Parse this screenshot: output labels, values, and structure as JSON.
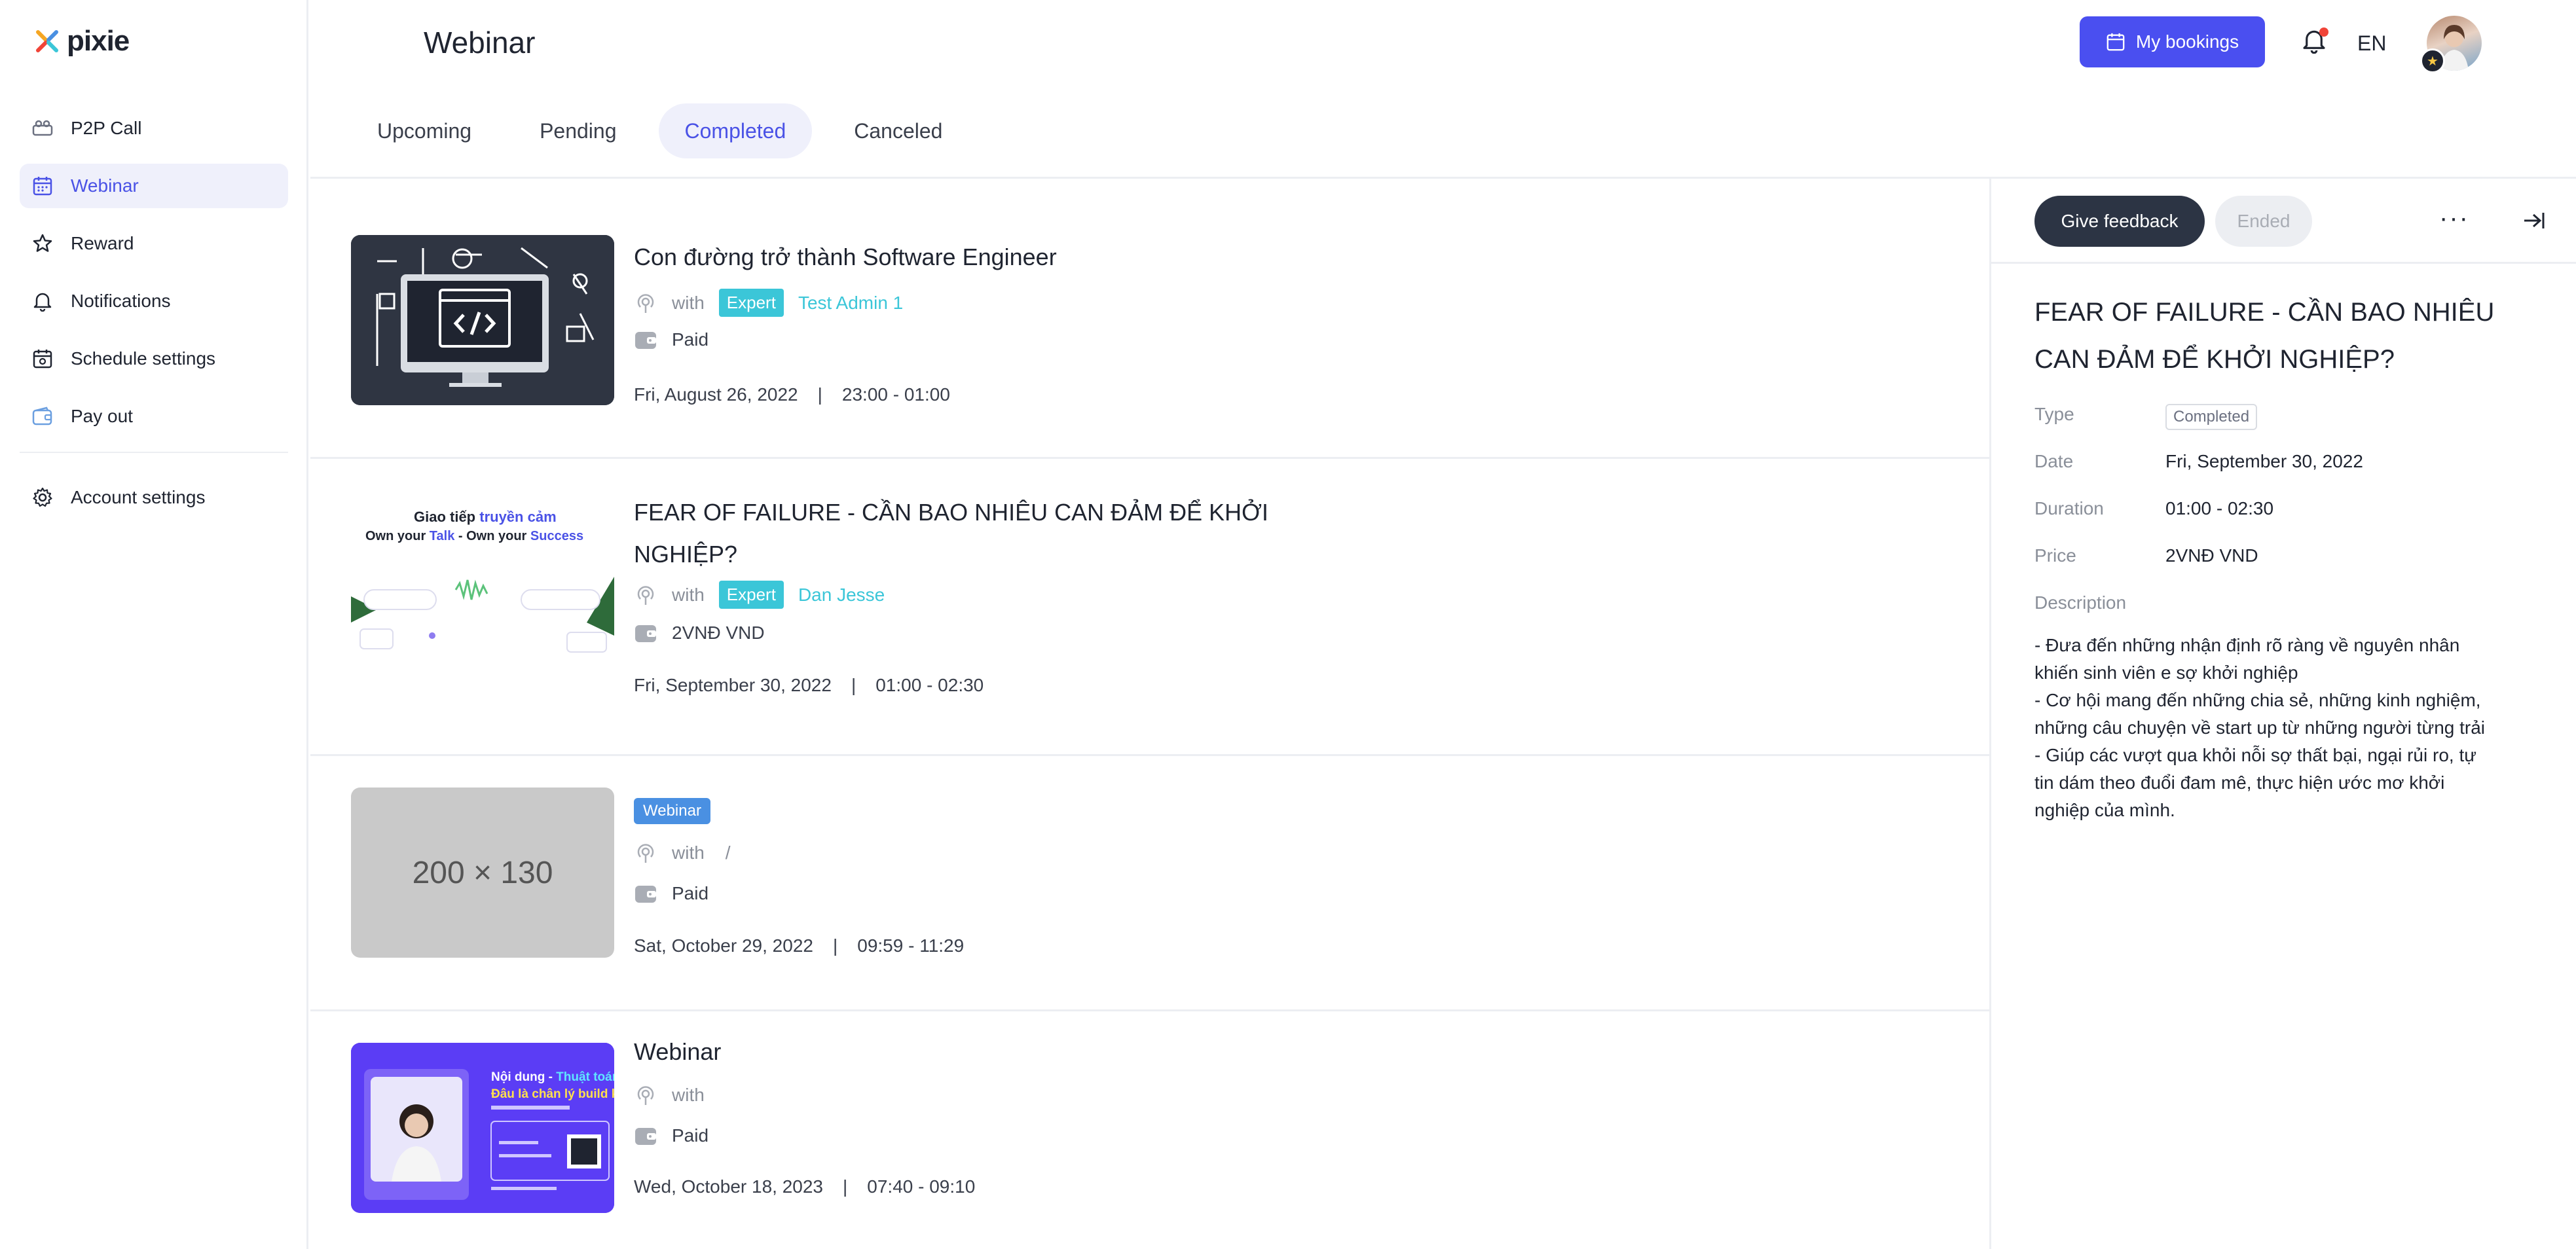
{
  "app": {
    "name": "pixie"
  },
  "sidebar": {
    "items": [
      {
        "label": "P2P Call",
        "icon": "video-call-icon"
      },
      {
        "label": "Webinar",
        "icon": "calendar-icon",
        "active": true
      },
      {
        "label": "Reward",
        "icon": "star-icon"
      },
      {
        "label": "Notifications",
        "icon": "bell-icon"
      },
      {
        "label": "Schedule settings",
        "icon": "calendar-settings-icon"
      },
      {
        "label": "Pay out",
        "icon": "wallet-icon"
      }
    ],
    "account": {
      "label": "Account settings",
      "icon": "gear-icon"
    }
  },
  "header": {
    "title": "Webinar",
    "bookings_label": "My bookings",
    "language": "EN"
  },
  "tabs": [
    {
      "label": "Upcoming"
    },
    {
      "label": "Pending"
    },
    {
      "label": "Completed",
      "active": true
    },
    {
      "label": "Canceled"
    }
  ],
  "webinars": [
    {
      "title": "Con đường trở thành Software Engineer",
      "with": "with",
      "expert_badge": "Expert",
      "expert_name": "Test Admin 1",
      "price": "Paid",
      "date": "Fri, August 26, 2022",
      "time": "23:00 - 01:00"
    },
    {
      "title": "FEAR OF FAILURE - CẦN BAO NHIÊU CAN ĐẢM ĐỂ KHỞI NGHIỆP?",
      "with": "with",
      "expert_badge": "Expert",
      "expert_name": "Dan Jesse",
      "price": "2VNĐ VND",
      "date": "Fri, September 30, 2022",
      "time": "01:00 - 02:30",
      "thumb_text_1": "Giao tiếp ",
      "thumb_text_1b": "truyền cảm",
      "thumb_text_2a": "Own your ",
      "thumb_text_2b": "Talk",
      "thumb_text_2c": " - Own your ",
      "thumb_text_2d": "Success"
    },
    {
      "badge": "Webinar",
      "with": "with",
      "slash": "/",
      "price": "Paid",
      "date": "Sat, October 29, 2022",
      "time": "09:59 - 11:29",
      "placeholder": "200 × 130"
    },
    {
      "title": "Webinar",
      "with": "with",
      "price": "Paid",
      "date": "Wed, October 18, 2023",
      "time": "07:40 - 09:10",
      "thumb_text_1": "Nội dung - ",
      "thumb_text_1b": "Thuật toán",
      "thumb_text_2": "Đâu là chân lý build k"
    }
  ],
  "panel": {
    "feedback_label": "Give feedback",
    "status_label": "Ended",
    "more_label": "···",
    "title": "FEAR OF FAILURE - CẦN BAO NHIÊU CAN ĐẢM ĐỂ KHỞI NGHIỆP?",
    "type_label": "Type",
    "type_value": "Completed",
    "date_label": "Date",
    "date_value": "Fri, September 30, 2022",
    "duration_label": "Duration",
    "duration_value": "01:00 - 02:30",
    "price_label": "Price",
    "price_value": "2VNĐ VND",
    "description_label": "Description",
    "description": "- Đưa đến những nhận định rõ ràng về nguyên nhân\nkhiến sinh viên e sợ khởi nghiệp\n- Cơ hội mang đến những chia sẻ, những kinh nghiệm,\nnhững câu chuyện về start up từ những người từng trải\n- Giúp các vượt qua khỏi nỗi sợ thất bại, ngại rủi ro, tự\ntin dám theo đuổi đam mê, thực hiện ước mơ khởi\nnghiệp của mình."
  },
  "colors": {
    "accent": "#4a4ff0",
    "expert": "#3bc6d8",
    "dark_button": "#2c3444"
  }
}
